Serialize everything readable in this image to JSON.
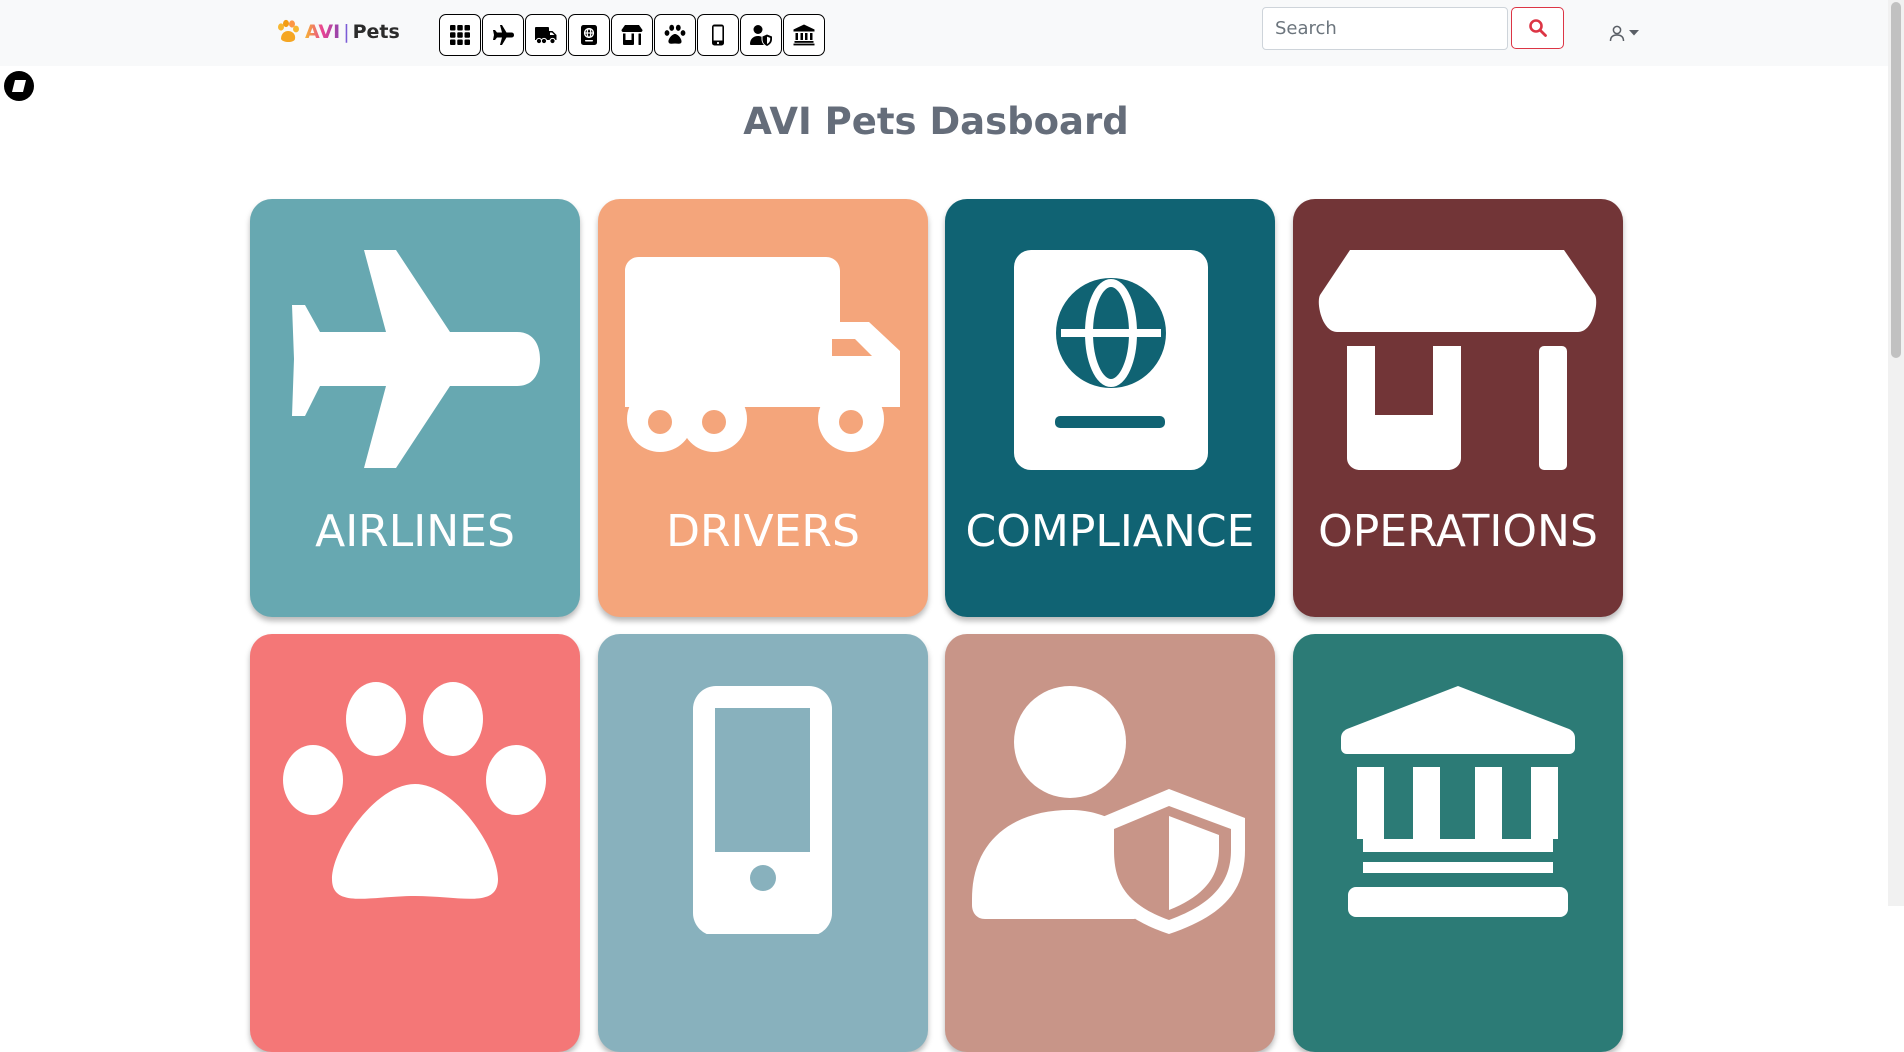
{
  "brand": {
    "avi": "AVI",
    "separator": "|",
    "pets": "Pets"
  },
  "toolbar": {
    "icons": [
      "grid-icon",
      "airplane-icon",
      "truck-icon",
      "passport-icon",
      "store-icon",
      "paw-icon",
      "mobile-icon",
      "user-shield-icon",
      "bank-icon"
    ]
  },
  "search": {
    "placeholder": "Search",
    "value": ""
  },
  "page": {
    "title": "AVI Pets Dasboard"
  },
  "cards": [
    {
      "label": "AIRLINES",
      "color": "#67a8b1",
      "icon": "airplane-icon"
    },
    {
      "label": "DRIVERS",
      "color": "#f4a57b",
      "icon": "truck-icon"
    },
    {
      "label": "COMPLIANCE",
      "color": "#106373",
      "icon": "passport-icon"
    },
    {
      "label": "OPERATIONS",
      "color": "#723537",
      "icon": "store-icon"
    },
    {
      "label": "",
      "color": "#f47777",
      "icon": "paw-icon"
    },
    {
      "label": "",
      "color": "#88b1bd",
      "icon": "mobile-icon"
    },
    {
      "label": "",
      "color": "#c89588",
      "icon": "user-shield-icon"
    },
    {
      "label": "",
      "color": "#2c7b76",
      "icon": "bank-icon"
    }
  ],
  "colors": {
    "accent": "#dc3545",
    "navbar": "#f8f9fa",
    "title": "#656d7a"
  }
}
